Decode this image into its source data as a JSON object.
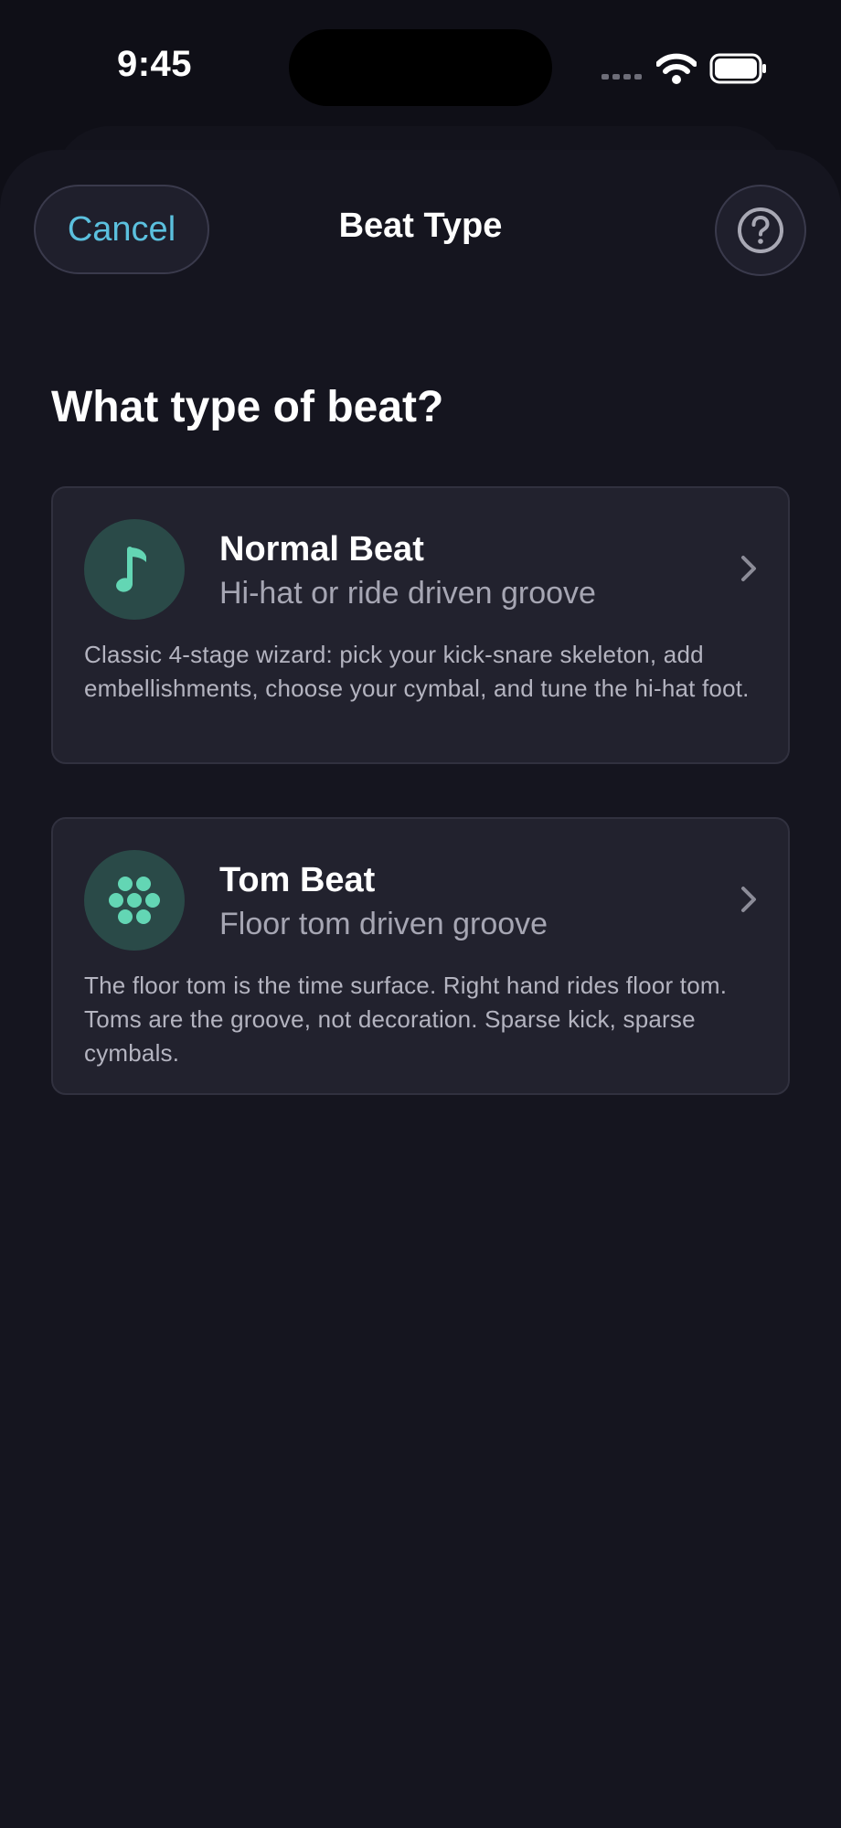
{
  "status_bar": {
    "time": "9:45",
    "icons": [
      "signal-icon",
      "wifi-icon",
      "battery-icon"
    ]
  },
  "nav": {
    "cancel_label": "Cancel",
    "title": "Beat Type",
    "help_icon": "question-circle-icon"
  },
  "heading": "What type of beat?",
  "cards": [
    {
      "icon": "music-note-icon",
      "title": "Normal Beat",
      "subtitle": "Hi-hat or ride driven groove",
      "description": "Classic 4-stage wizard: pick your kick-snare skeleton, add embellishments, choose your cymbal, and tune the hi-hat foot."
    },
    {
      "icon": "drum-cluster-icon",
      "title": "Tom Beat",
      "subtitle": "Floor tom driven groove",
      "description": "The floor tom is the time surface. Right hand rides floor tom. Toms are the groove, not decoration. Sparse kick, sparse cymbals."
    }
  ],
  "colors": {
    "background": "#0f0f17",
    "sheet": "#15151f",
    "card": "#22222e",
    "accent": "#5bc0de",
    "icon_accent": "#63d6b4",
    "icon_circle": "#2a4a48"
  }
}
